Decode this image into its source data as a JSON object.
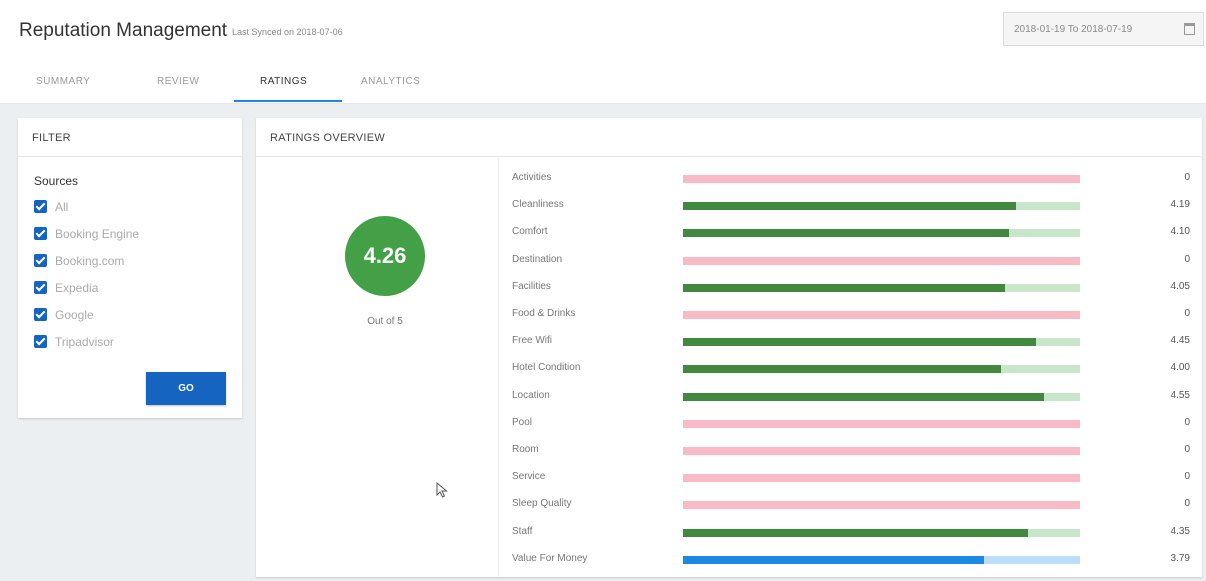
{
  "header": {
    "title": "Reputation Management",
    "last_synced": "Last Synced on 2018-07-06",
    "date_range": "2018-01-19 To 2018-07-19"
  },
  "tabs": [
    {
      "label": "SUMMARY",
      "active": false
    },
    {
      "label": "REVIEW",
      "active": false
    },
    {
      "label": "RATINGS",
      "active": true
    },
    {
      "label": "ANALYTICS",
      "active": false
    }
  ],
  "filter": {
    "title": "FILTER",
    "sources_label": "Sources",
    "sources": [
      {
        "label": "All",
        "checked": true
      },
      {
        "label": "Booking Engine",
        "checked": true
      },
      {
        "label": "Booking.com",
        "checked": true
      },
      {
        "label": "Expedia",
        "checked": true
      },
      {
        "label": "Google",
        "checked": true
      },
      {
        "label": "Tripadvisor",
        "checked": true
      }
    ],
    "go_label": "GO"
  },
  "overview": {
    "title": "RATINGS OVERVIEW",
    "score": "4.26",
    "out_of": "Out of 5"
  },
  "colors": {
    "accent": "#1565c0",
    "tab_underline": "#1e88e5",
    "score_green": "#43a047",
    "bar_green": "#43883f",
    "track_green": "#c8e6c9",
    "bar_blue": "#1e88e5",
    "track_blue": "#bbdefb",
    "track_empty": "#f8bbc6"
  },
  "chart_data": {
    "type": "bar",
    "orientation": "horizontal",
    "max": 5,
    "categories": [
      "Activities",
      "Cleanliness",
      "Comfort",
      "Destination",
      "Facilities",
      "Food & Drinks",
      "Free Wifi",
      "Hotel Condition",
      "Location",
      "Pool",
      "Room",
      "Service",
      "Sleep Quality",
      "Staff",
      "Value For Money"
    ],
    "values": [
      0,
      4.19,
      4.1,
      0,
      4.05,
      0,
      4.45,
      4.0,
      4.55,
      0,
      0,
      0,
      0,
      4.35,
      3.79
    ],
    "labels": [
      "0",
      "4.19",
      "4.10",
      "0",
      "4.05",
      "0",
      "4.45",
      "4.00",
      "4.55",
      "0",
      "0",
      "0",
      "0",
      "4.35",
      "3.79"
    ],
    "bar_colors": [
      "none",
      "green",
      "green",
      "none",
      "green",
      "none",
      "green",
      "green",
      "green",
      "none",
      "none",
      "none",
      "none",
      "green",
      "blue"
    ]
  }
}
